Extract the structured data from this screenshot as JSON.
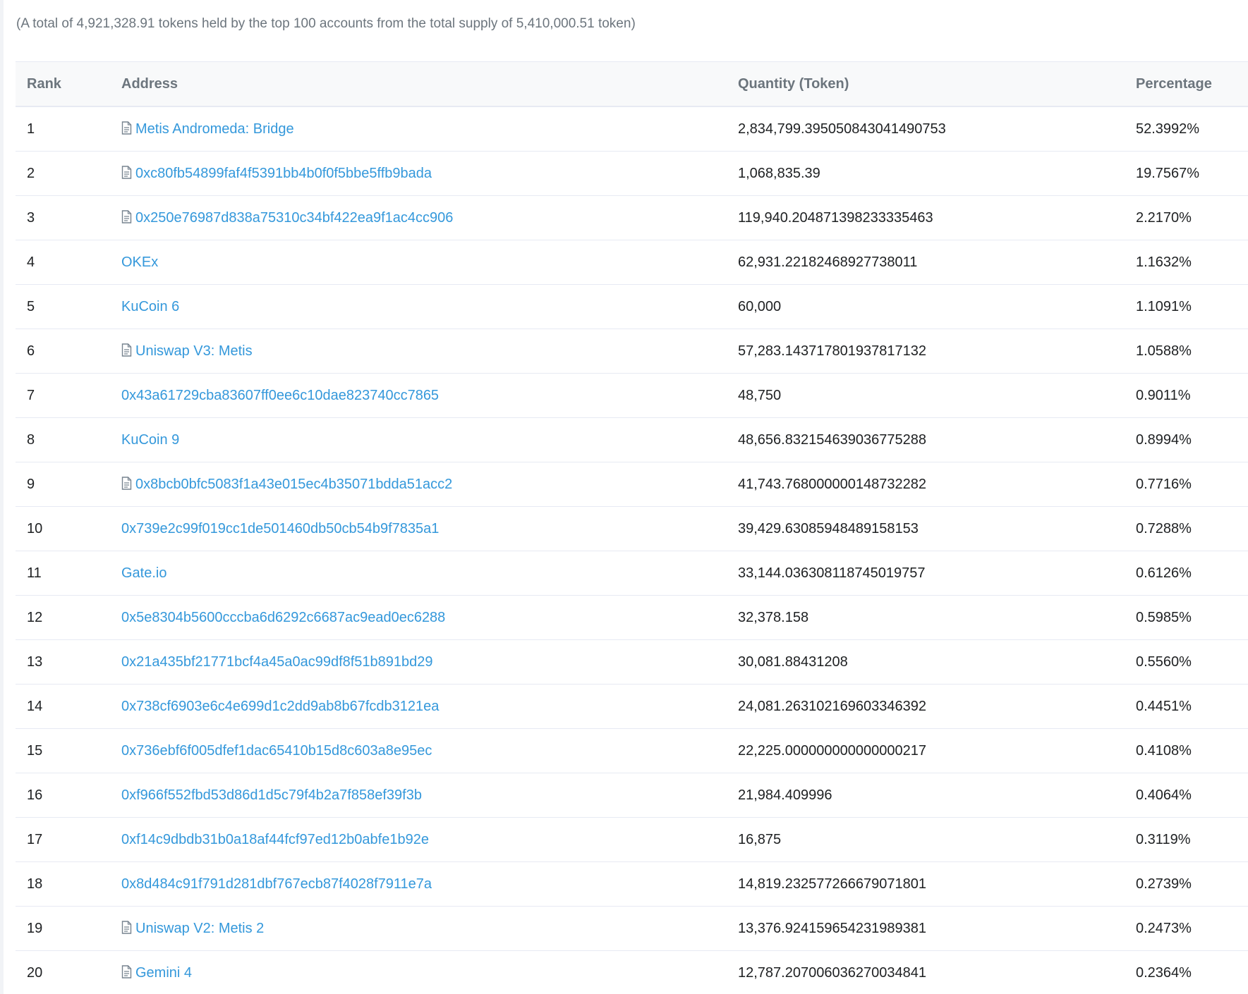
{
  "summary": "(A total of 4,921,328.91 tokens held by the top 100 accounts from the total supply of 5,410,000.51 token)",
  "table": {
    "headers": {
      "rank": "Rank",
      "address": "Address",
      "quantity": "Quantity (Token)",
      "percentage": "Percentage"
    },
    "rows": [
      {
        "rank": "1",
        "address": "Metis Andromeda: Bridge",
        "contract": true,
        "quantity": "2,834,799.395050843041490753",
        "percentage": "52.3992%"
      },
      {
        "rank": "2",
        "address": "0xc80fb54899faf4f5391bb4b0f0f5bbe5ffb9bada",
        "contract": true,
        "quantity": "1,068,835.39",
        "percentage": "19.7567%"
      },
      {
        "rank": "3",
        "address": "0x250e76987d838a75310c34bf422ea9f1ac4cc906",
        "contract": true,
        "quantity": "119,940.204871398233335463",
        "percentage": "2.2170%"
      },
      {
        "rank": "4",
        "address": "OKEx",
        "contract": false,
        "quantity": "62,931.22182468927738011",
        "percentage": "1.1632%"
      },
      {
        "rank": "5",
        "address": "KuCoin 6",
        "contract": false,
        "quantity": "60,000",
        "percentage": "1.1091%"
      },
      {
        "rank": "6",
        "address": "Uniswap V3: Metis",
        "contract": true,
        "quantity": "57,283.143717801937817132",
        "percentage": "1.0588%"
      },
      {
        "rank": "7",
        "address": "0x43a61729cba83607ff0ee6c10dae823740cc7865",
        "contract": false,
        "quantity": "48,750",
        "percentage": "0.9011%"
      },
      {
        "rank": "8",
        "address": "KuCoin 9",
        "contract": false,
        "quantity": "48,656.832154639036775288",
        "percentage": "0.8994%"
      },
      {
        "rank": "9",
        "address": "0x8bcb0bfc5083f1a43e015ec4b35071bdda51acc2",
        "contract": true,
        "quantity": "41,743.768000000148732282",
        "percentage": "0.7716%"
      },
      {
        "rank": "10",
        "address": "0x739e2c99f019cc1de501460db50cb54b9f7835a1",
        "contract": false,
        "quantity": "39,429.63085948489158153",
        "percentage": "0.7288%"
      },
      {
        "rank": "11",
        "address": "Gate.io",
        "contract": false,
        "quantity": "33,144.036308118745019757",
        "percentage": "0.6126%"
      },
      {
        "rank": "12",
        "address": "0x5e8304b5600cccba6d6292c6687ac9ead0ec6288",
        "contract": false,
        "quantity": "32,378.158",
        "percentage": "0.5985%"
      },
      {
        "rank": "13",
        "address": "0x21a435bf21771bcf4a45a0ac99df8f51b891bd29",
        "contract": false,
        "quantity": "30,081.88431208",
        "percentage": "0.5560%"
      },
      {
        "rank": "14",
        "address": "0x738cf6903e6c4e699d1c2dd9ab8b67fcdb3121ea",
        "contract": false,
        "quantity": "24,081.263102169603346392",
        "percentage": "0.4451%"
      },
      {
        "rank": "15",
        "address": "0x736ebf6f005dfef1dac65410b15d8c603a8e95ec",
        "contract": false,
        "quantity": "22,225.000000000000000217",
        "percentage": "0.4108%"
      },
      {
        "rank": "16",
        "address": "0xf966f552fbd53d86d1d5c79f4b2a7f858ef39f3b",
        "contract": false,
        "quantity": "21,984.409996",
        "percentage": "0.4064%"
      },
      {
        "rank": "17",
        "address": "0xf14c9dbdb31b0a18af44fcf97ed12b0abfe1b92e",
        "contract": false,
        "quantity": "16,875",
        "percentage": "0.3119%"
      },
      {
        "rank": "18",
        "address": "0x8d484c91f791d281dbf767ecb87f4028f7911e7a",
        "contract": false,
        "quantity": "14,819.232577266679071801",
        "percentage": "0.2739%"
      },
      {
        "rank": "19",
        "address": "Uniswap V2: Metis 2",
        "contract": true,
        "quantity": "13,376.924159654231989381",
        "percentage": "0.2473%"
      },
      {
        "rank": "20",
        "address": "Gemini 4",
        "contract": true,
        "quantity": "12,787.207006036270034841",
        "percentage": "0.2364%"
      }
    ]
  },
  "icons": {
    "contract": "file-text-icon"
  },
  "colors": {
    "link": "#3498db",
    "muted": "#6c757d",
    "text": "#1e2022"
  }
}
